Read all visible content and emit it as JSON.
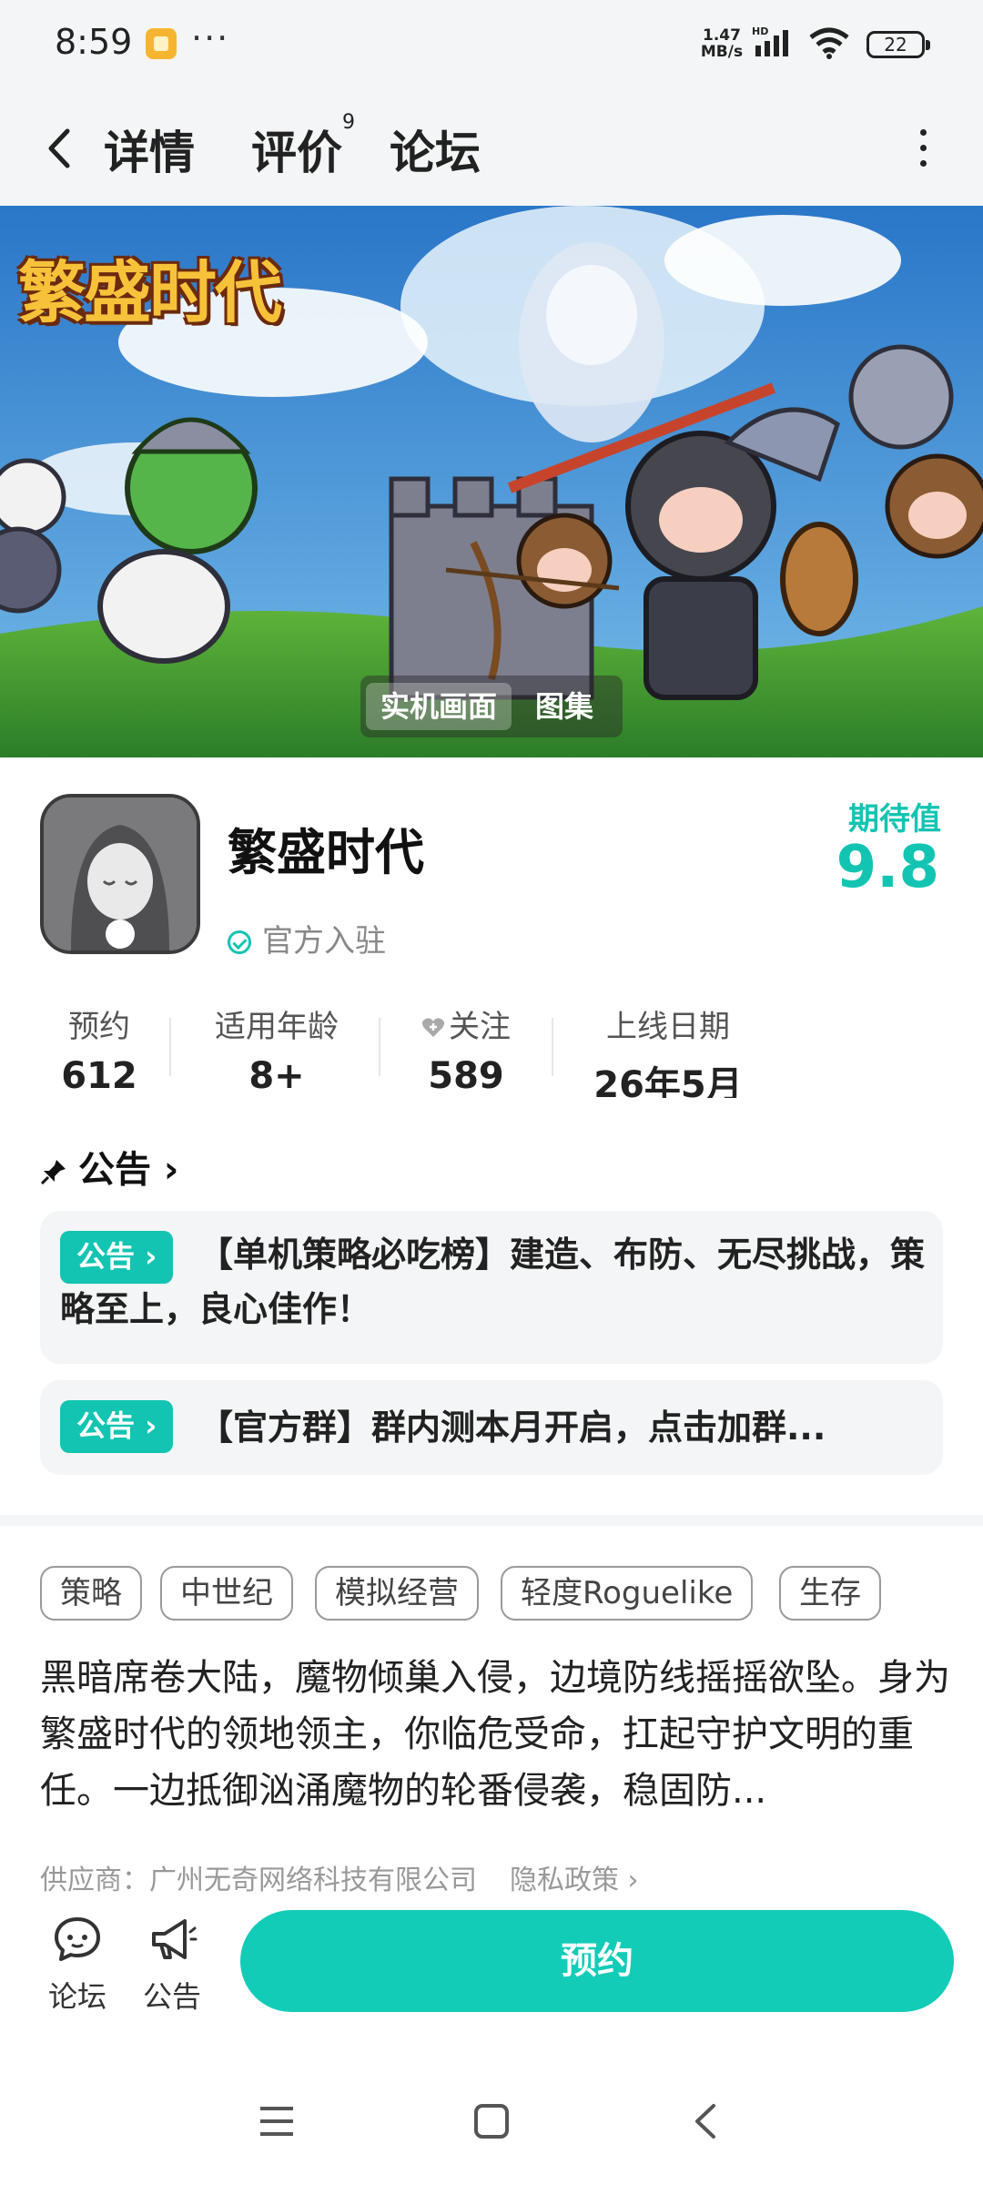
{
  "status_bar": {
    "time": "8:59",
    "dots": "···",
    "network_speed": "1.47 MB/s",
    "network_type": "HD",
    "battery": "22"
  },
  "nav": {
    "tabs": [
      {
        "label": "详情",
        "active": true
      },
      {
        "label": "评价",
        "count": "9"
      },
      {
        "label": "论坛"
      }
    ]
  },
  "banner": {
    "logo_text": "繁盛时代",
    "switch": [
      "实机画面",
      "图集"
    ]
  },
  "app": {
    "name": "繁盛时代",
    "official_label": "官方入驻",
    "expect_label": "期待值",
    "expect_value": "9.8"
  },
  "stats": [
    {
      "label": "预约",
      "value": "612"
    },
    {
      "label": "适用年龄",
      "value": "8+"
    },
    {
      "label": "关注",
      "value": "589"
    },
    {
      "label": "上线日期",
      "value": "26年5月"
    }
  ],
  "notices": {
    "header": "公告",
    "items": [
      {
        "badge": "公告",
        "text": "【单机策略必吃榜】建造、布防、无尽挑战，策略至上，良心佳作！"
      },
      {
        "badge": "公告",
        "text": "【官方群】群内测本月开启，点击加群..."
      }
    ]
  },
  "tags": [
    "策略",
    "中世纪",
    "模拟经营",
    "轻度Roguelike",
    "生存"
  ],
  "description": "黑暗席卷大陆，魔物倾巢入侵，边境防线摇摇欲坠。身为繁盛时代的领地领主，你临危受命，扛起守护文明的重任。一边抵御汹涌魔物的轮番侵袭，稳固防...",
  "supplier": {
    "text": "供应商：广州无奇网络科技有限公司",
    "privacy": "隐私政策 ›"
  },
  "bottom_bar": {
    "forum": "论坛",
    "notice": "公告",
    "reserve": "预约"
  },
  "colors": {
    "accent": "#13c4b2",
    "background": "#f4f5f7"
  }
}
